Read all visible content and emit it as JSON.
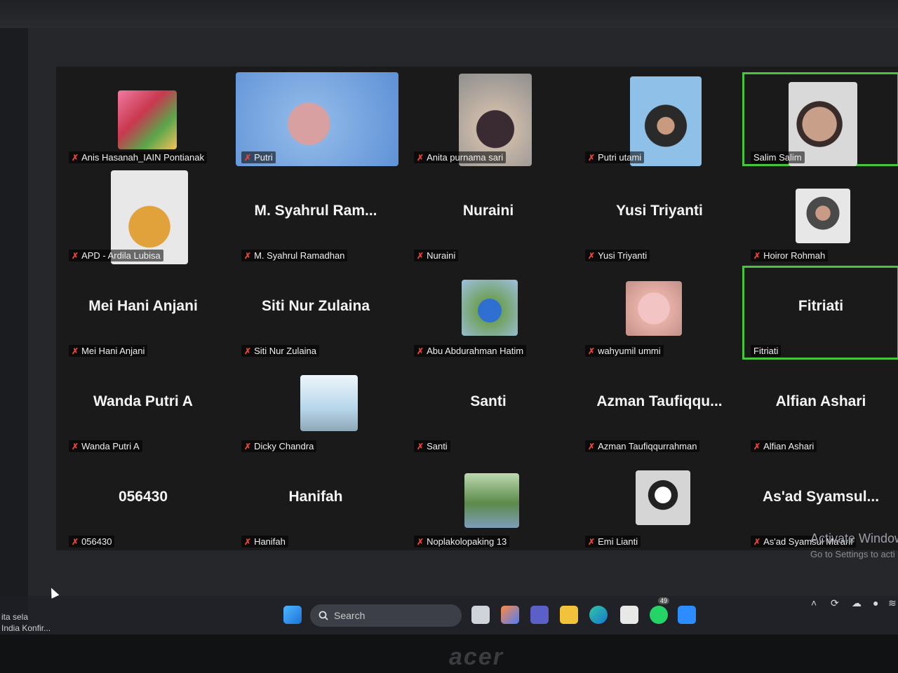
{
  "participants": [
    {
      "big": "",
      "label": "Anis Hasanah_IAIN Pontianak",
      "mic_off": true,
      "video": "flowers"
    },
    {
      "big": "",
      "label": "Putri",
      "mic_off": true,
      "video": "woman-headphones"
    },
    {
      "big": "",
      "label": "Anita purnama sari",
      "mic_off": true,
      "video": "woman-hijab"
    },
    {
      "big": "",
      "label": "Putri utami",
      "mic_off": true,
      "video": "woman-hijab-2"
    },
    {
      "big": "",
      "label": "Salim Salim",
      "mic_off": false,
      "video": "man-face",
      "active": true
    },
    {
      "big": "",
      "label": "APD - Ardila Lubisa",
      "mic_off": true,
      "video": "woman-yellow"
    },
    {
      "big": "M. Syahrul Ram...",
      "label": "M. Syahrul Ramadhan",
      "mic_off": true
    },
    {
      "big": "Nuraini",
      "label": "Nuraini",
      "mic_off": true
    },
    {
      "big": "Yusi Triyanti",
      "label": "Yusi Triyanti",
      "mic_off": true
    },
    {
      "big": "",
      "label": "Hoiror Rohmah",
      "mic_off": true,
      "video": "woman-hijab-3"
    },
    {
      "big": "Mei Hani Anjani",
      "label": "Mei Hani Anjani",
      "mic_off": true
    },
    {
      "big": "Siti Nur Zulaina",
      "label": "Siti Nur Zulaina",
      "mic_off": true
    },
    {
      "big": "",
      "label": "Abu Abdurahman Hatim",
      "mic_off": true,
      "video": "man-blue"
    },
    {
      "big": "",
      "label": "wahyumil ummi",
      "mic_off": true,
      "video": "eyes"
    },
    {
      "big": "Fitriati",
      "label": "Fitriati",
      "mic_off": false,
      "active": true
    },
    {
      "big": "Wanda Putri A",
      "label": "Wanda Putri A",
      "mic_off": true
    },
    {
      "big": "",
      "label": "Dicky Chandra",
      "mic_off": true,
      "video": "sky"
    },
    {
      "big": "Santi",
      "label": "Santi",
      "mic_off": true
    },
    {
      "big": "Azman Taufiqqu...",
      "label": "Azman Taufiqqurrahman",
      "mic_off": true
    },
    {
      "big": "Alfian Ashari",
      "label": "Alfian Ashari",
      "mic_off": true
    },
    {
      "big": "056430",
      "label": "056430",
      "mic_off": true
    },
    {
      "big": "Hanifah",
      "label": "Hanifah",
      "mic_off": true
    },
    {
      "big": "",
      "label": "Noplakolopaking 13",
      "mic_off": true,
      "video": "landscape"
    },
    {
      "big": "",
      "label": "Emi Lianti",
      "mic_off": true,
      "video": "man-cap"
    },
    {
      "big": "As'ad Syamsul...",
      "label": "As'ad Syamsul Ma'arif",
      "mic_off": true
    }
  ],
  "watermark": {
    "line1": "Activate Window",
    "line2": "Go to Settings to acti"
  },
  "left_note": {
    "line1": "ita sela",
    "line2": "India Konfir..."
  },
  "taskbar": {
    "search_label": "Search",
    "whatsapp_badge": "49",
    "icons": [
      "windows-start-icon",
      "copilot-icon",
      "task-view-icon",
      "teams-icon",
      "file-explorer-icon",
      "edge-icon",
      "store-icon",
      "whatsapp-icon",
      "zoom-icon"
    ]
  },
  "brand": "acer",
  "colors": {
    "active_speaker": "#4ac43f",
    "mic_muted": "#e5443b"
  }
}
